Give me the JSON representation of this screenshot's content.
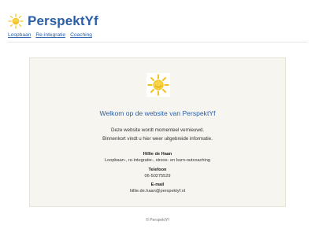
{
  "site": {
    "brand": "PerspektYf",
    "logo_icon": "sun-logo-icon",
    "brand_color": "#2a5fa8",
    "sun_color": "#f3c21a"
  },
  "nav": [
    {
      "label": "Loopbaan"
    },
    {
      "label": "Re-integratie"
    },
    {
      "label": "Coaching"
    }
  ],
  "main": {
    "welcome": "Welkom op de website van PerspektYf",
    "line1": "Deze website wordt momenteel vernieuwd.",
    "line2": "Binnenkort vindt u hier weer uitgebreide informatie.",
    "contact": {
      "name": "Hillie de Haan",
      "services": "Loopbaan-, re-integratie-, stress- en burn-outcoaching",
      "phone_label": "Telefoon",
      "phone": "06-50275529",
      "email_label": "E-mail",
      "email": "hillie.de.haan@perspektyf.nl"
    }
  },
  "footer": {
    "copyright": "© PerspektYf"
  }
}
